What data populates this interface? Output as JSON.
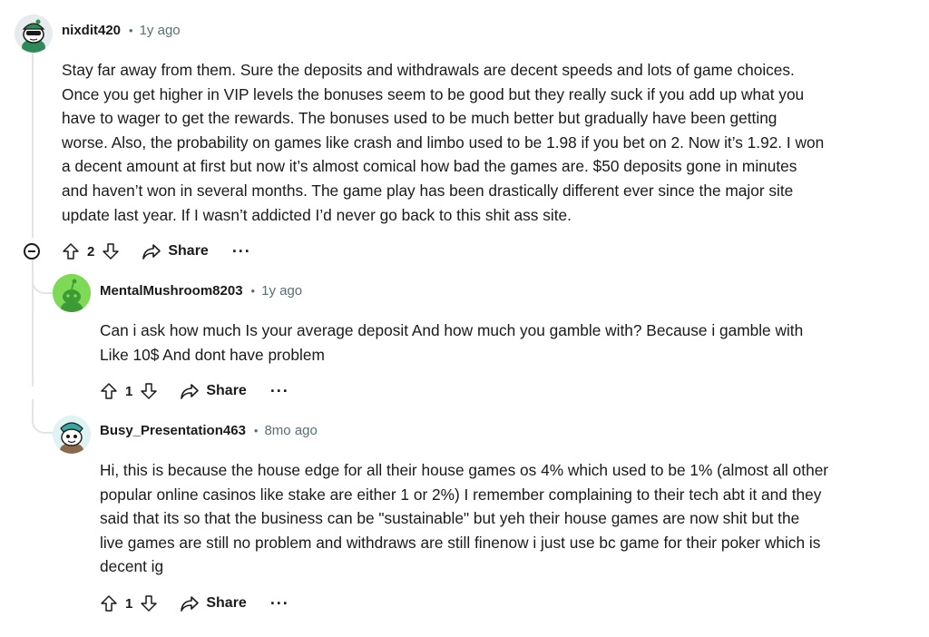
{
  "comments": [
    {
      "username": "nixdit420",
      "time": "1y ago",
      "lines": [
        "Stay far away from them. Sure the deposits and withdrawals are decent speeds and lots of game choices.",
        "Once you get higher in VIP levels the bonuses seem to be good but they really suck if you add up what you",
        "have to wager to get the rewards. The bonuses used to be much better but gradually have been getting",
        "worse. Also, the probability on games like crash and limbo used to be 1.98 if you bet on 2. Now it’s 1.92. I won",
        "a decent amount at first but now it’s almost comical how bad the games are. $50 deposits gone in minutes",
        "and haven’t won in several months. The game play has been drastically different ever since the major site",
        "update last year. If I wasn’t addicted I’d never go back to this shit ass site."
      ],
      "votes": "2",
      "share": "Share",
      "more": "···",
      "avatar_colors": {
        "bg": "#e7ebee",
        "main": "#2e8b57"
      }
    },
    {
      "username": "MentalMushroom8203",
      "time": "1y ago",
      "lines": [
        "Can i ask how much Is your average deposit And how much you gamble with? Because i gamble with",
        "Like 10$ And dont have problem"
      ],
      "votes": "1",
      "share": "Share",
      "more": "···",
      "avatar_colors": {
        "bg": "#7ed957",
        "main": "#3d9b35"
      }
    },
    {
      "username": "Busy_Presentation463",
      "time": "8mo ago",
      "lines": [
        "Hi, this is because the house edge for all their house games os 4% which used to be 1% (almost all other",
        "popular online casinos like stake are either 1 or 2%) I remember complaining to their tech abt it and they",
        "said that its so that the business can be \"sustainable\" but yeh their house games are now shit but the",
        "live games are still no problem and withdraws are still finenow i just use bc game for their poker which is",
        "decent ig"
      ],
      "votes": "1",
      "share": "Share",
      "more": "···",
      "avatar_colors": {
        "bg": "#dff3f3",
        "main": "#3aa6a6"
      }
    }
  ],
  "dot_separator": "•"
}
